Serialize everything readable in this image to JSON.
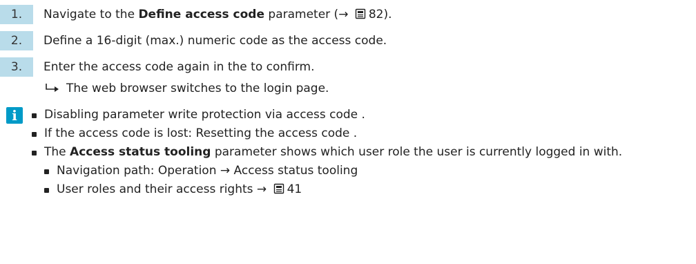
{
  "steps": [
    {
      "num": "1.",
      "pre": "Navigate to the ",
      "bold": "Define access code",
      "post": " parameter (→ ",
      "page": "82",
      "tail": ")."
    },
    {
      "num": "2.",
      "text": "Define a 16-digit (max.) numeric code as the access code."
    },
    {
      "num": "3.",
      "text": "Enter the access code again in the to confirm."
    }
  ],
  "result_text": "The web browser switches to the login page.",
  "notes": {
    "item1": "Disabling parameter write protection via access code .",
    "item2": "If the access code is lost: Resetting the access code .",
    "item3_pre": "The ",
    "item3_bold": "Access status tooling",
    "item3_post": " parameter shows which user role the user is currently logged in with.",
    "sub1": "Navigation path: Operation → Access status tooling",
    "sub2_pre": "User roles and their access rights → ",
    "sub2_page": "41"
  },
  "colors": {
    "step_bg": "#b9dcea",
    "info_icon": "#009ac7"
  },
  "icons": {
    "page_ref": "book-icon",
    "info": "info-icon",
    "result": "result-arrow-icon"
  }
}
